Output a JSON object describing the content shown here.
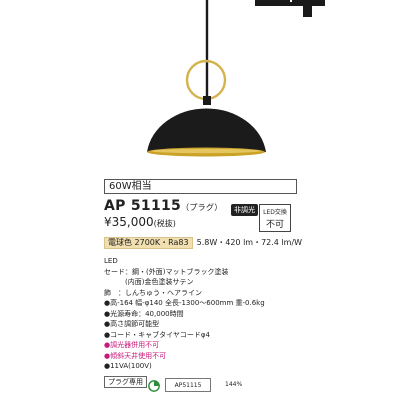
{
  "wattage": "60W相当",
  "model": "AP 51115",
  "plug_note": "（プラグ）",
  "price": "¥35,000",
  "tax_note": "(税抜)",
  "dimming": "非調光",
  "led": {
    "line1": "LED交換",
    "line2": "不可"
  },
  "spec": {
    "color_temp": "電球色 2700K・Ra83",
    "performance": "5.8W・420 lm・72.4 lm/W"
  },
  "details": [
    {
      "text": "LED",
      "style": "normal"
    },
    {
      "text": "セード：鋼・(外面)マットブラック塗装",
      "style": "normal"
    },
    {
      "text": "(内面)金色塗装サテン",
      "style": "indent"
    },
    {
      "text": "飾　：しんちゅう・ヘアライン",
      "style": "normal"
    },
    {
      "text": "●高-164 幅-φ140 全長-1300～600mm 重-0.6kg",
      "style": "normal"
    },
    {
      "text": "●光源寿命：40,000時間",
      "style": "normal"
    },
    {
      "text": "●高さ調節可能型",
      "style": "normal"
    },
    {
      "text": "●コード・キャブタイヤコードφ4",
      "style": "normal"
    },
    {
      "text": "●調光器併用不可",
      "style": "warn"
    },
    {
      "text": "●傾斜天井使用不可",
      "style": "warn"
    },
    {
      "text": "●11VA(100V)",
      "style": "normal"
    }
  ],
  "plug_only": "プラグ専用",
  "code_label": "AP51115",
  "ratio": "144%",
  "colors": {
    "shade_outer": "#1a1a1a",
    "shade_inner": "#c9a227",
    "ring": "#d4b24c",
    "warn_text": "#c8197c",
    "highlight": "#f1dfb0"
  }
}
